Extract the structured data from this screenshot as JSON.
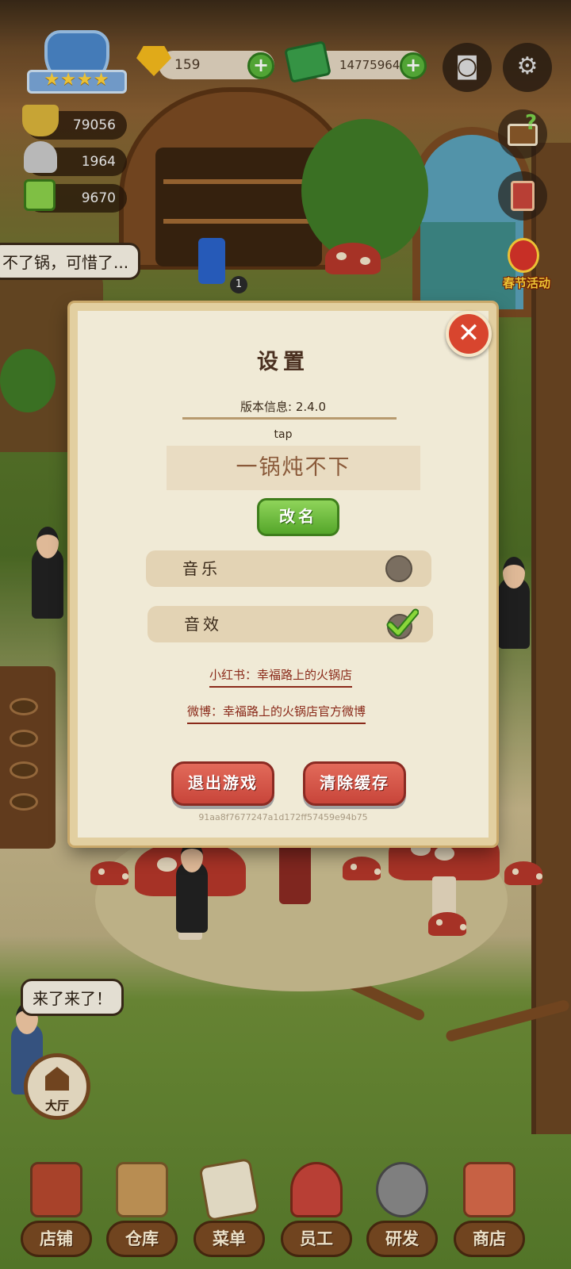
{
  "hud": {
    "gems": "159",
    "cash": "14775964",
    "stat_pot": "79056",
    "stat_dish": "1964",
    "stat_money": "9670"
  },
  "scene": {
    "bubble_top": "不了锅，可惜了...",
    "bubble_bottom": "来了来了！",
    "item_count": "1",
    "event_label": "春节活动",
    "hall_label": "大厅"
  },
  "nav": {
    "items": [
      {
        "label": "店铺",
        "icon": "shop-icon"
      },
      {
        "label": "仓库",
        "icon": "warehouse-icon"
      },
      {
        "label": "菜单",
        "icon": "menu-clipboard-icon"
      },
      {
        "label": "员工",
        "icon": "staff-icon"
      },
      {
        "label": "研发",
        "icon": "research-pot-icon"
      },
      {
        "label": "商店",
        "icon": "store-icon"
      }
    ]
  },
  "settings": {
    "title": "设置",
    "version": "版本信息: 2.4.0",
    "player_id": "tap",
    "player_name": "一锅炖不下",
    "rename_label": "改名",
    "music_label": "音乐",
    "music_on": false,
    "sfx_label": "音效",
    "sfx_on": true,
    "xiaohongshu": "小红书：幸福路上的火锅店",
    "weibo": "微博：幸福路上的火锅店官方微博",
    "exit_label": "退出游戏",
    "clear_cache_label": "清除缓存",
    "hash": "91aa8f7677247a1d172ff57459e94b75",
    "close_icon": "close-icon"
  },
  "colors": {
    "accent_green": "#58b23a",
    "button_red": "#c8453a",
    "panel_bg": "#f0ead6"
  }
}
